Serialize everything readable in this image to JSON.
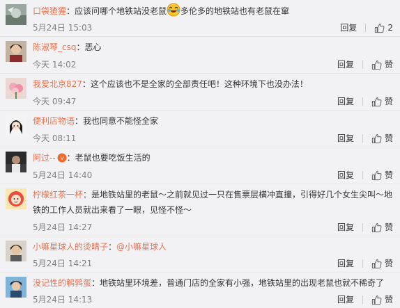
{
  "colors": {
    "username": "#eb7350",
    "meta": "#808080",
    "text": "#333333"
  },
  "comments": [
    {
      "user": "口袋猹猩",
      "text_before": "：应该问哪个地铁站没老鼠",
      "emoji": "laughing-crying-emoji",
      "text_after": "多伦多的地铁站也有老鼠在窜",
      "time": "5月24日 15:03",
      "reply_label": "回复",
      "like_label": "2"
    },
    {
      "user": "陈淑琴_csq",
      "text": "：恶心",
      "time": "今天 14:02",
      "reply_label": "回复",
      "like_label": "赞"
    },
    {
      "user": "我爱北京827",
      "text": "：这个应该也不是全家的全部责任吧！这种环境下也没办法！",
      "time": "今天 09:47",
      "reply_label": "回复",
      "like_label": "赞"
    },
    {
      "user": "便利店物语",
      "text": "：我也同意不能怪全家",
      "time": "今天 08:11",
      "reply_label": "回复",
      "like_label": "赞"
    },
    {
      "user": "阿过--",
      "badge": "member-badge-icon",
      "text": "：老鼠也要吃饭生活的",
      "time": "5月24日 14:40",
      "reply_label": "回复",
      "like_label": "赞"
    },
    {
      "user": "柠檬红茶一杯",
      "text": "：是地铁站里的老鼠～之前就见过一只在售票层横冲直撞，引得好几个女生尖叫～地铁的工作人员就出来看了一眼，见怪不怪～",
      "time": "5月24日 14:27",
      "reply_label": "回复",
      "like_label": "赞"
    },
    {
      "user": "小嘛星球人的烫晴子",
      "text_before": "：",
      "mention": "@小嘛星球人",
      "time": "5月24日 14:21",
      "reply_label": "回复",
      "like_label": "赞"
    },
    {
      "user": "没记性的鹌鹑蛋",
      "text": "：地铁站里环境差，普通门店的全家有小强，地铁站里的出现老鼠也就不稀奇了",
      "time": "5月24日 14:13",
      "reply_label": "回复",
      "like_label": "赞"
    }
  ]
}
